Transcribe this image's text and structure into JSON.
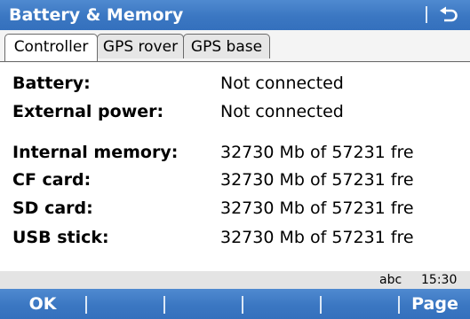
{
  "window": {
    "title": "Battery & Memory",
    "back_icon": "return-arrow-icon"
  },
  "tabs": [
    {
      "label": "Controller",
      "active": true
    },
    {
      "label": "GPS rover",
      "active": false
    },
    {
      "label": "GPS base",
      "active": false
    }
  ],
  "power": [
    {
      "label": "Battery:",
      "value": "Not connected"
    },
    {
      "label": "External power:",
      "value": "Not connected"
    }
  ],
  "memory": [
    {
      "label": "Internal memory:",
      "value": "32730 Mb of 57231 fre"
    },
    {
      "label": "CF card:",
      "value": "32730 Mb of 57231 fre"
    },
    {
      "label": "SD card:",
      "value": "32730 Mb of 57231 fre"
    },
    {
      "label": "USB stick:",
      "value": "32730 Mb of 57231 fre"
    }
  ],
  "status": {
    "input_mode": "abc",
    "time": "15:30"
  },
  "softkeys": [
    {
      "label": "OK"
    },
    {
      "label": ""
    },
    {
      "label": ""
    },
    {
      "label": ""
    },
    {
      "label": ""
    },
    {
      "label": "Page"
    }
  ],
  "colors": {
    "bar_blue": "#3b77c2",
    "status_gray": "#e4e4e4"
  }
}
